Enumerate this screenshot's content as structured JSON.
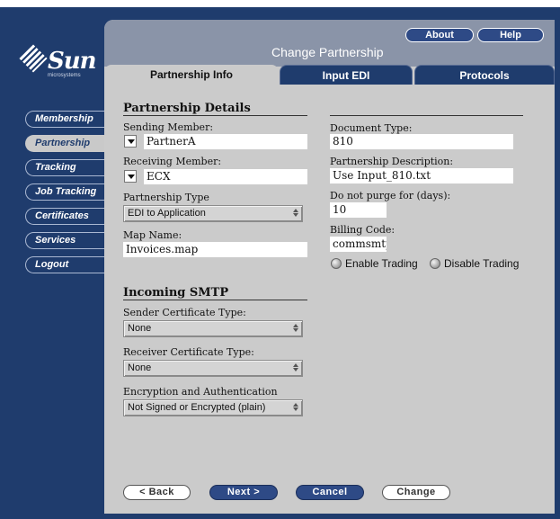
{
  "brand": {
    "name": "Sun",
    "tagline": "microsystems"
  },
  "header": {
    "title": "Change Partnership",
    "about_label": "About",
    "help_label": "Help"
  },
  "tabs": [
    {
      "label": "Partnership Info",
      "active": true
    },
    {
      "label": "Input EDI",
      "active": false
    },
    {
      "label": "Protocols",
      "active": false
    }
  ],
  "nav": [
    {
      "label": "Membership",
      "active": false
    },
    {
      "label": "Partnership",
      "active": true
    },
    {
      "label": "Tracking",
      "active": false
    },
    {
      "label": "Job Tracking",
      "active": false
    },
    {
      "label": "Certificates",
      "active": false
    },
    {
      "label": "Services",
      "active": false
    },
    {
      "label": "Logout",
      "active": false
    }
  ],
  "details": {
    "title": "Partnership Details",
    "sending_member_label": "Sending Member:",
    "sending_member_value": "PartnerA",
    "receiving_member_label": "Receiving Member:",
    "receiving_member_value": "ECX",
    "partnership_type_label": "Partnership Type",
    "partnership_type_value": "EDI to Application",
    "map_name_label": "Map Name:",
    "map_name_value": "Invoices.map"
  },
  "right": {
    "document_type_label": "Document Type:",
    "document_type_value": "810",
    "description_label": "Partnership Description:",
    "description_value": "Use Input_810.txt",
    "purge_label": "Do not purge for (days):",
    "purge_value": "10",
    "billing_label": "Billing Code:",
    "billing_value": "commsmtp",
    "enable_label": "Enable Trading",
    "disable_label": "Disable Trading"
  },
  "smtp": {
    "title": "Incoming SMTP",
    "sender_cert_label": "Sender Certificate Type:",
    "sender_cert_value": "None",
    "receiver_cert_label": "Receiver Certificate Type:",
    "receiver_cert_value": "None",
    "encryption_label": "Encryption and Authentication",
    "encryption_value": "Not Signed or Encrypted (plain)"
  },
  "footer": {
    "back_label": "< Back",
    "next_label": "Next >",
    "cancel_label": "Cancel",
    "change_label": "Change"
  }
}
